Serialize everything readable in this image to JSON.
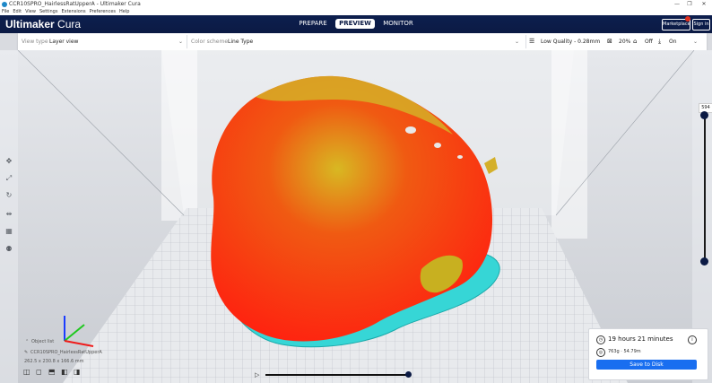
{
  "window": {
    "title": "CCR10SPRO_HairlessRatUpperA - Ultimaker Cura",
    "controls": [
      "—",
      "❐",
      "✕"
    ]
  },
  "menu": [
    "File",
    "Edit",
    "View",
    "Settings",
    "Extensions",
    "Preferences",
    "Help"
  ],
  "header": {
    "logo_bold": "Ultimaker",
    "logo_light": " Cura",
    "tabs": [
      "PREPARE",
      "PREVIEW",
      "MONITOR"
    ],
    "active_tab": "PREVIEW",
    "marketplace": "Marketplace",
    "signin": "Sign in"
  },
  "toolbar": {
    "view_type_label": "View type",
    "view_type_value": "Layer view",
    "color_scheme_label": "Color scheme",
    "color_scheme_value": "Line Type",
    "quality": "Low Quality - 0.28mm",
    "infill": "20%",
    "support": "Off",
    "adhesion": "On"
  },
  "left_tools": [
    "move-icon",
    "scale-icon",
    "rotate-icon",
    "mirror-icon",
    "per-model-settings-icon",
    "support-blocker-icon"
  ],
  "layer_slider": {
    "top_layer": "594",
    "min_layer": 1,
    "max_layer": 594
  },
  "object_list": {
    "label": "Object list",
    "object_name": "CCR10SPRO_HairlessRatUpperA",
    "dimensions": "262.5 x 230.8 x 166.6 mm"
  },
  "playback": {
    "position": 0.98
  },
  "print_info": {
    "time": "19 hours 21 minutes",
    "material": "763g · 54.79m",
    "save": "Save to Disk"
  },
  "colors": {
    "header": "#0b1a44",
    "accent": "#196ef0",
    "model_red": "#ff2a10",
    "model_yellow": "#d4c020",
    "skirt": "#2ad4d4"
  }
}
